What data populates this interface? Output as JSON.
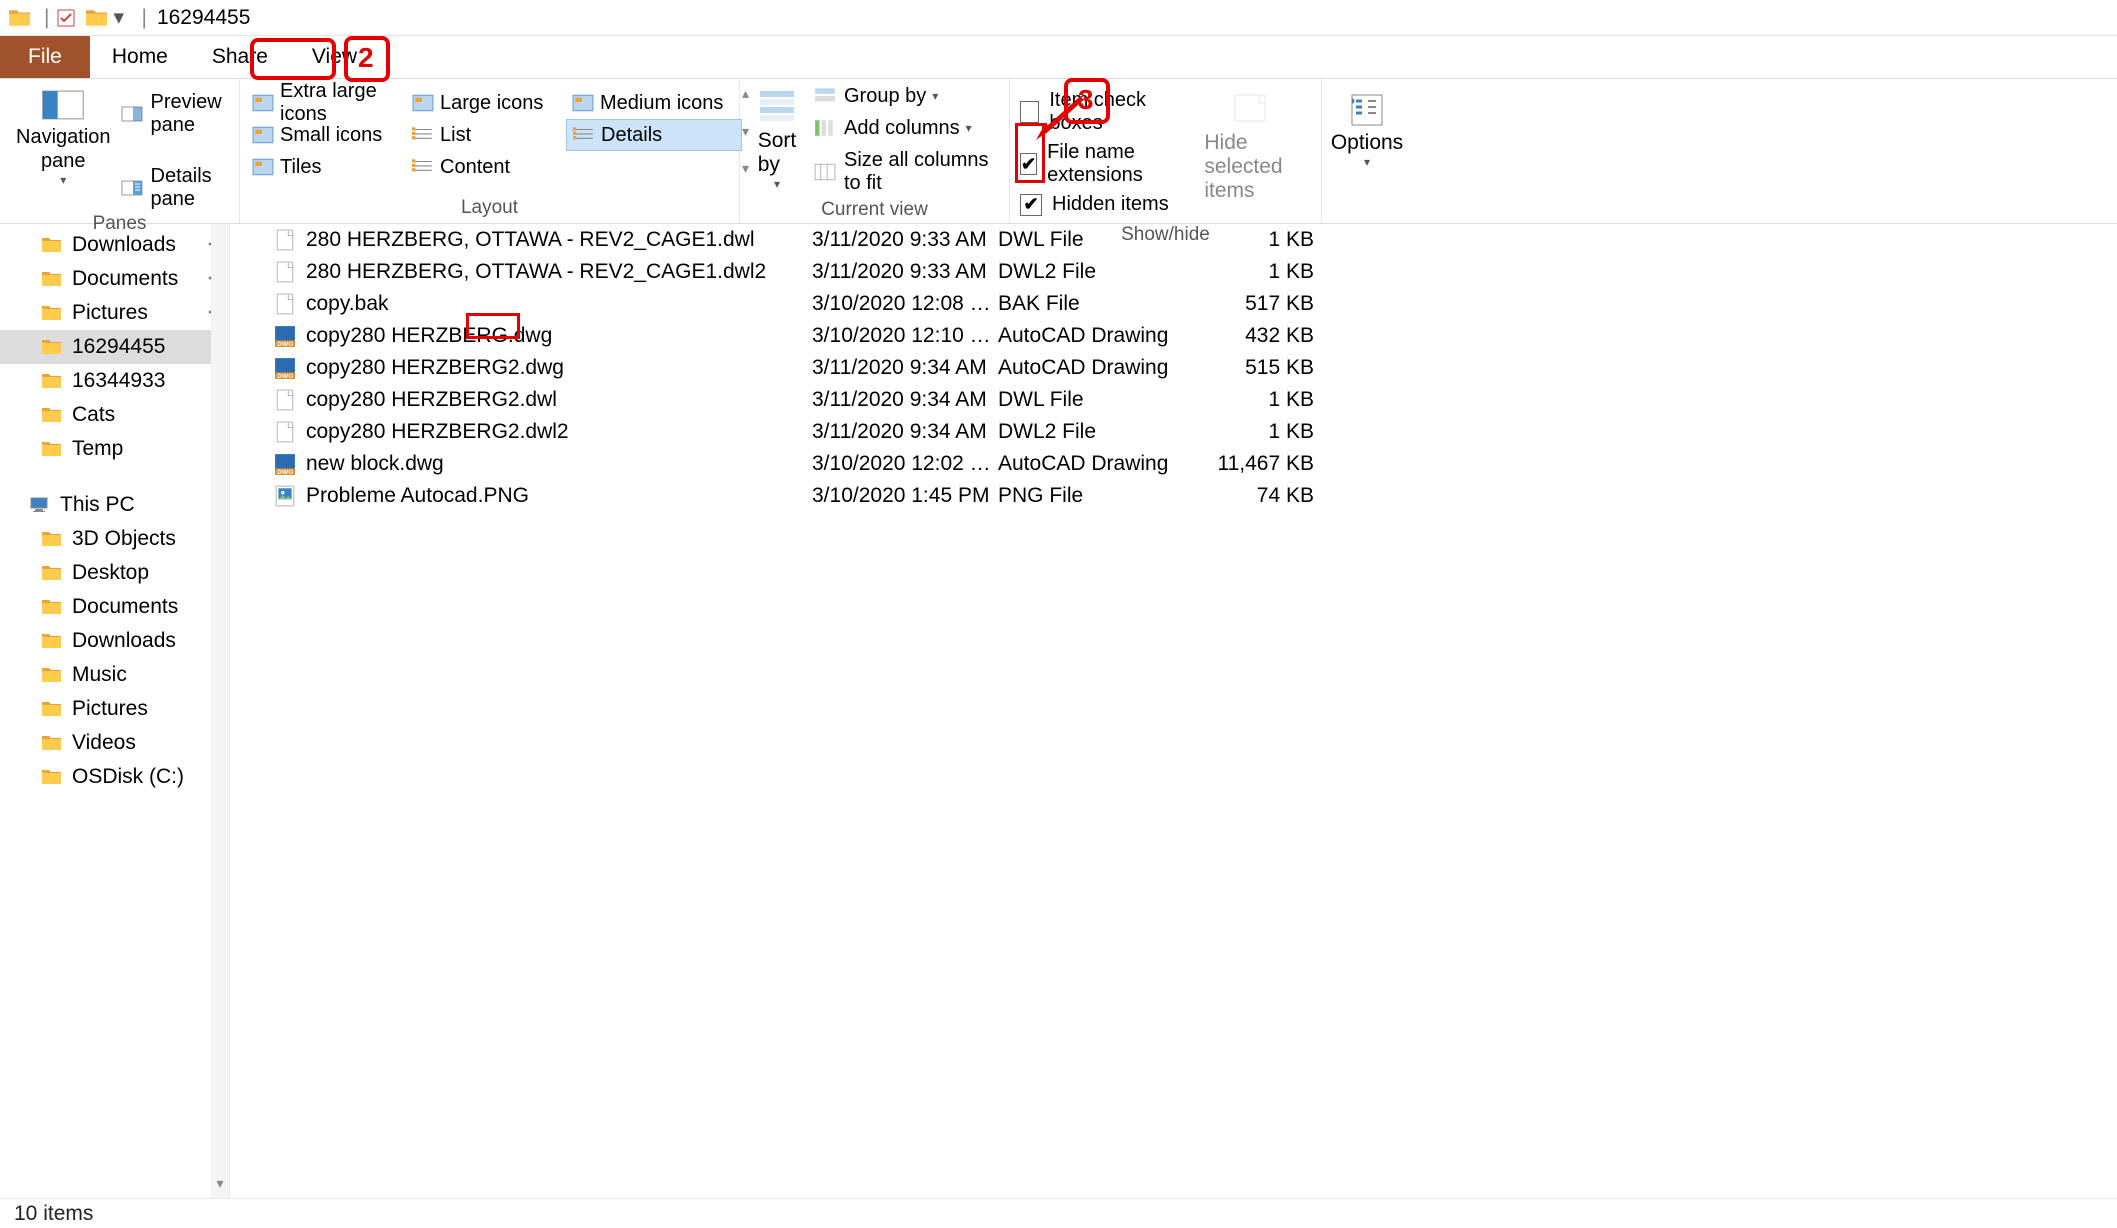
{
  "window": {
    "title": "16294455"
  },
  "tabs": {
    "file": "File",
    "home": "Home",
    "share": "Share",
    "view": "View"
  },
  "ribbon": {
    "panes": {
      "label": "Panes",
      "navigation": "Navigation\npane",
      "preview": "Preview pane",
      "details": "Details pane"
    },
    "layout": {
      "label": "Layout",
      "extra_large": "Extra large icons",
      "large": "Large icons",
      "medium": "Medium icons",
      "small": "Small icons",
      "list": "List",
      "details": "Details",
      "tiles": "Tiles",
      "content": "Content"
    },
    "current_view": {
      "label": "Current view",
      "sort_by": "Sort\nby",
      "group_by": "Group by",
      "add_columns": "Add columns",
      "size_all": "Size all columns to fit"
    },
    "showhide": {
      "label": "Show/hide",
      "item_check": "Item check boxes",
      "file_ext": "File name extensions",
      "hidden": "Hidden items",
      "hide_selected": "Hide selected\nitems",
      "options": "Options",
      "file_ext_checked": true,
      "hidden_checked": true,
      "item_check_checked": false
    }
  },
  "nav": {
    "quick": [
      {
        "label": "Downloads",
        "pinned": true
      },
      {
        "label": "Documents",
        "pinned": true
      },
      {
        "label": "Pictures",
        "pinned": true
      },
      {
        "label": "16294455",
        "pinned": false,
        "selected": true
      },
      {
        "label": "16344933",
        "pinned": false
      },
      {
        "label": "Cats",
        "pinned": false
      },
      {
        "label": "Temp",
        "pinned": false
      }
    ],
    "this_pc": "This PC",
    "pc_children": [
      {
        "label": "3D Objects"
      },
      {
        "label": "Desktop"
      },
      {
        "label": "Documents"
      },
      {
        "label": "Downloads"
      },
      {
        "label": "Music"
      },
      {
        "label": "Pictures"
      },
      {
        "label": "Videos"
      },
      {
        "label": "OSDisk (C:)"
      }
    ]
  },
  "files": [
    {
      "name": "280 HERZBERG, OTTAWA - REV2_CAGE1.dwl",
      "date": "3/11/2020 9:33 AM",
      "type": "DWL File",
      "size": "1 KB",
      "icon": "file"
    },
    {
      "name": "280 HERZBERG, OTTAWA - REV2_CAGE1.dwl2",
      "date": "3/11/2020 9:33 AM",
      "type": "DWL2 File",
      "size": "1 KB",
      "icon": "file"
    },
    {
      "name": "copy.bak",
      "date": "3/10/2020 12:08 …",
      "type": "BAK File",
      "size": "517 KB",
      "icon": "file"
    },
    {
      "name": "copy280 HERZBERG.dwg",
      "date": "3/10/2020 12:10 …",
      "type": "AutoCAD Drawing",
      "size": "432 KB",
      "icon": "dwg"
    },
    {
      "name": "copy280 HERZBERG2.dwg",
      "date": "3/11/2020 9:34 AM",
      "type": "AutoCAD Drawing",
      "size": "515 KB",
      "icon": "dwg"
    },
    {
      "name": "copy280 HERZBERG2.dwl",
      "date": "3/11/2020 9:34 AM",
      "type": "DWL File",
      "size": "1 KB",
      "icon": "file"
    },
    {
      "name": "copy280 HERZBERG2.dwl2",
      "date": "3/11/2020 9:34 AM",
      "type": "DWL2 File",
      "size": "1 KB",
      "icon": "file"
    },
    {
      "name": "new block.dwg",
      "date": "3/10/2020 12:02 …",
      "type": "AutoCAD Drawing",
      "size": "11,467 KB",
      "icon": "dwg"
    },
    {
      "name": "Probleme Autocad.PNG",
      "date": "3/10/2020 1:45 PM",
      "type": "PNG File",
      "size": "74 KB",
      "icon": "png"
    }
  ],
  "status": {
    "items": "10 items"
  },
  "annotations": {
    "n2": "2",
    "n3": "3"
  }
}
